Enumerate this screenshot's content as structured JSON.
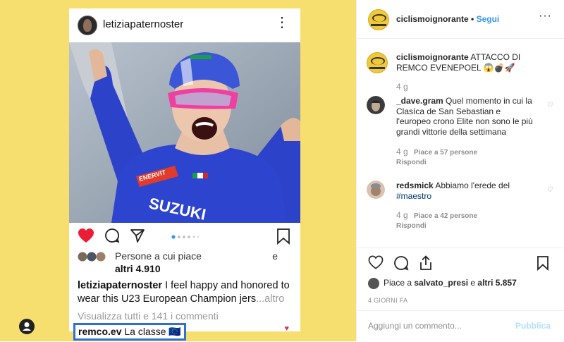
{
  "post_image": {
    "username": "letiziapaternoster",
    "likes_line1": "Persone a cui piace",
    "likes_e": "e",
    "likes_line2": "altri 4.910",
    "caption_user": "letiziapaternoster",
    "caption_text": " I feel happy and honored to wear this U23 European Champion jers",
    "caption_more": "...altro",
    "view_all": "Visualizza tutti e 141 i commenti",
    "highlighted_comment_user": "remco.ev",
    "highlighted_comment_text": " La classe 🇪🇺",
    "photo_text_enervit": "ENERVIT",
    "photo_text_suzuki": "SUZUKI"
  },
  "header": {
    "username": "ciclismoignorante",
    "separator": " • ",
    "follow": "Segui",
    "menu": "···"
  },
  "comments": [
    {
      "user": "ciclismoignorante",
      "text": " ATTACCO DI REMCO EVENEPOEL 😱💣🚀",
      "time": "4 g"
    },
    {
      "user": "_dave.gram",
      "text": " Quel momento in cui la Clasíca de San Sebastian e l'europeo crono Elite non sono le più grandi vittorie della settimana",
      "time": "4 g",
      "likes": "Piace a 57 persone",
      "reply": "Rispondi"
    },
    {
      "user": "redsmick",
      "text": " Abbiamo l'erede del ",
      "hashtag": "#maestro",
      "time": "4 g",
      "likes": "Piace a 42 persone",
      "reply": "Rispondi"
    }
  ],
  "likes": {
    "prefix": "Piace a ",
    "user": "salvato_presi",
    "middle": " e ",
    "others": "altri 5.857"
  },
  "date": "4 GIORNI FA",
  "add_comment": {
    "placeholder": "Aggiungi un commento...",
    "publish": "Pubblica"
  },
  "colors": {
    "background_yellow": "#f7df6f",
    "link_blue": "#3897f0",
    "like_red": "#e1306c",
    "highlight_border": "#2f6fd6"
  },
  "icons": [
    "heart-icon",
    "comment-icon",
    "share-icon",
    "bookmark-icon",
    "more-icon",
    "user-icon"
  ]
}
